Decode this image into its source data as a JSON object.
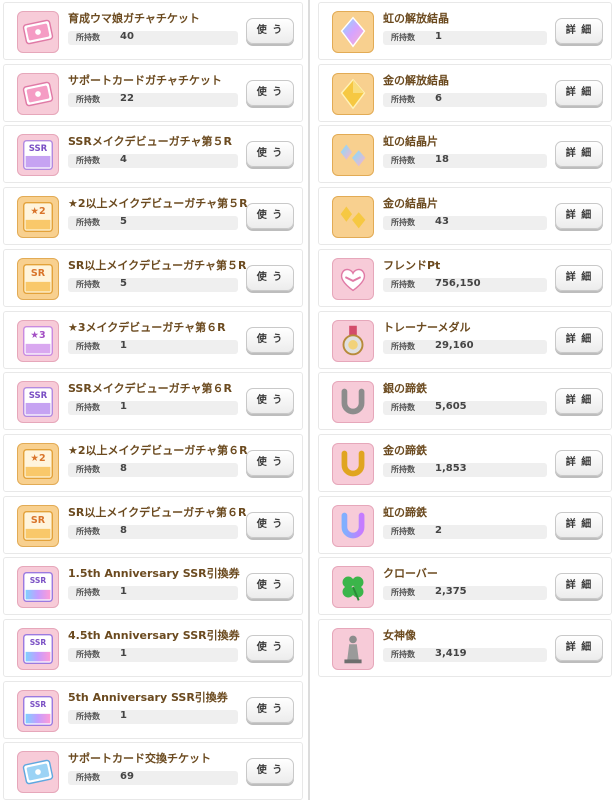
{
  "labels": {
    "owned": "所持数",
    "use": "使 う",
    "details": "詳 細"
  },
  "colors": {
    "item_name": "#6b4a1f",
    "pink_tile": "#f7cbd8",
    "orange_tile": "#f8d08f"
  },
  "left_items": [
    {
      "name": "育成ウマ娘ガチャチケット",
      "count": "40",
      "icon": "ticket-pink-icon",
      "tile": "pink"
    },
    {
      "name": "サポートカードガチャチケット",
      "count": "22",
      "icon": "ticket-pink-icon",
      "tile": "pink"
    },
    {
      "name": "SSRメイクデビューガチャ第５R",
      "count": "4",
      "icon": "ssr-ticket-icon",
      "tile": "pink"
    },
    {
      "name": "★2以上メイクデビューガチャ第５R",
      "count": "5",
      "icon": "star2-ticket-icon",
      "tile": "orange"
    },
    {
      "name": "SR以上メイクデビューガチャ第５R",
      "count": "5",
      "icon": "sr-ticket-icon",
      "tile": "orange"
    },
    {
      "name": "★3メイクデビューガチャ第６R",
      "count": "1",
      "icon": "star3-ticket-icon",
      "tile": "pink"
    },
    {
      "name": "SSRメイクデビューガチャ第６R",
      "count": "1",
      "icon": "ssr-ticket-icon",
      "tile": "pink"
    },
    {
      "name": "★2以上メイクデビューガチャ第６R",
      "count": "8",
      "icon": "star2-ticket-icon",
      "tile": "orange"
    },
    {
      "name": "SR以上メイクデビューガチャ第６R",
      "count": "8",
      "icon": "sr-ticket-icon",
      "tile": "orange"
    },
    {
      "name": "1.5th Anniversary SSR引換券",
      "count": "1",
      "icon": "anniversary-ticket-icon",
      "tile": "pink"
    },
    {
      "name": "4.5th Anniversary SSR引換券",
      "count": "1",
      "icon": "anniversary-ticket-icon",
      "tile": "pink"
    },
    {
      "name": "5th Anniversary SSR引換券",
      "count": "1",
      "icon": "anniversary-ticket-icon",
      "tile": "pink"
    },
    {
      "name": "サポートカード交換チケット",
      "count": "69",
      "icon": "ticket-blue-icon",
      "tile": "pink"
    }
  ],
  "right_items": [
    {
      "name": "虹の解放結晶",
      "count": "1",
      "icon": "rainbow-crystal-icon",
      "tile": "orange"
    },
    {
      "name": "金の解放結晶",
      "count": "6",
      "icon": "gold-crystal-icon",
      "tile": "orange"
    },
    {
      "name": "虹の結晶片",
      "count": "18",
      "icon": "rainbow-shard-icon",
      "tile": "orange"
    },
    {
      "name": "金の結晶片",
      "count": "43",
      "icon": "gold-shard-icon",
      "tile": "orange"
    },
    {
      "name": "フレンドPt",
      "count": "756,150",
      "icon": "handshake-heart-icon",
      "tile": "pink"
    },
    {
      "name": "トレーナーメダル",
      "count": "29,160",
      "icon": "medal-icon",
      "tile": "pink"
    },
    {
      "name": "銀の蹄鉄",
      "count": "5,605",
      "icon": "silver-horseshoe-icon",
      "tile": "pink"
    },
    {
      "name": "金の蹄鉄",
      "count": "1,853",
      "icon": "gold-horseshoe-icon",
      "tile": "pink"
    },
    {
      "name": "虹の蹄鉄",
      "count": "2",
      "icon": "rainbow-horseshoe-icon",
      "tile": "pink"
    },
    {
      "name": "クローバー",
      "count": "2,375",
      "icon": "clover-icon",
      "tile": "pink"
    },
    {
      "name": "女神像",
      "count": "3,419",
      "icon": "goddess-statue-icon",
      "tile": "pink"
    }
  ]
}
